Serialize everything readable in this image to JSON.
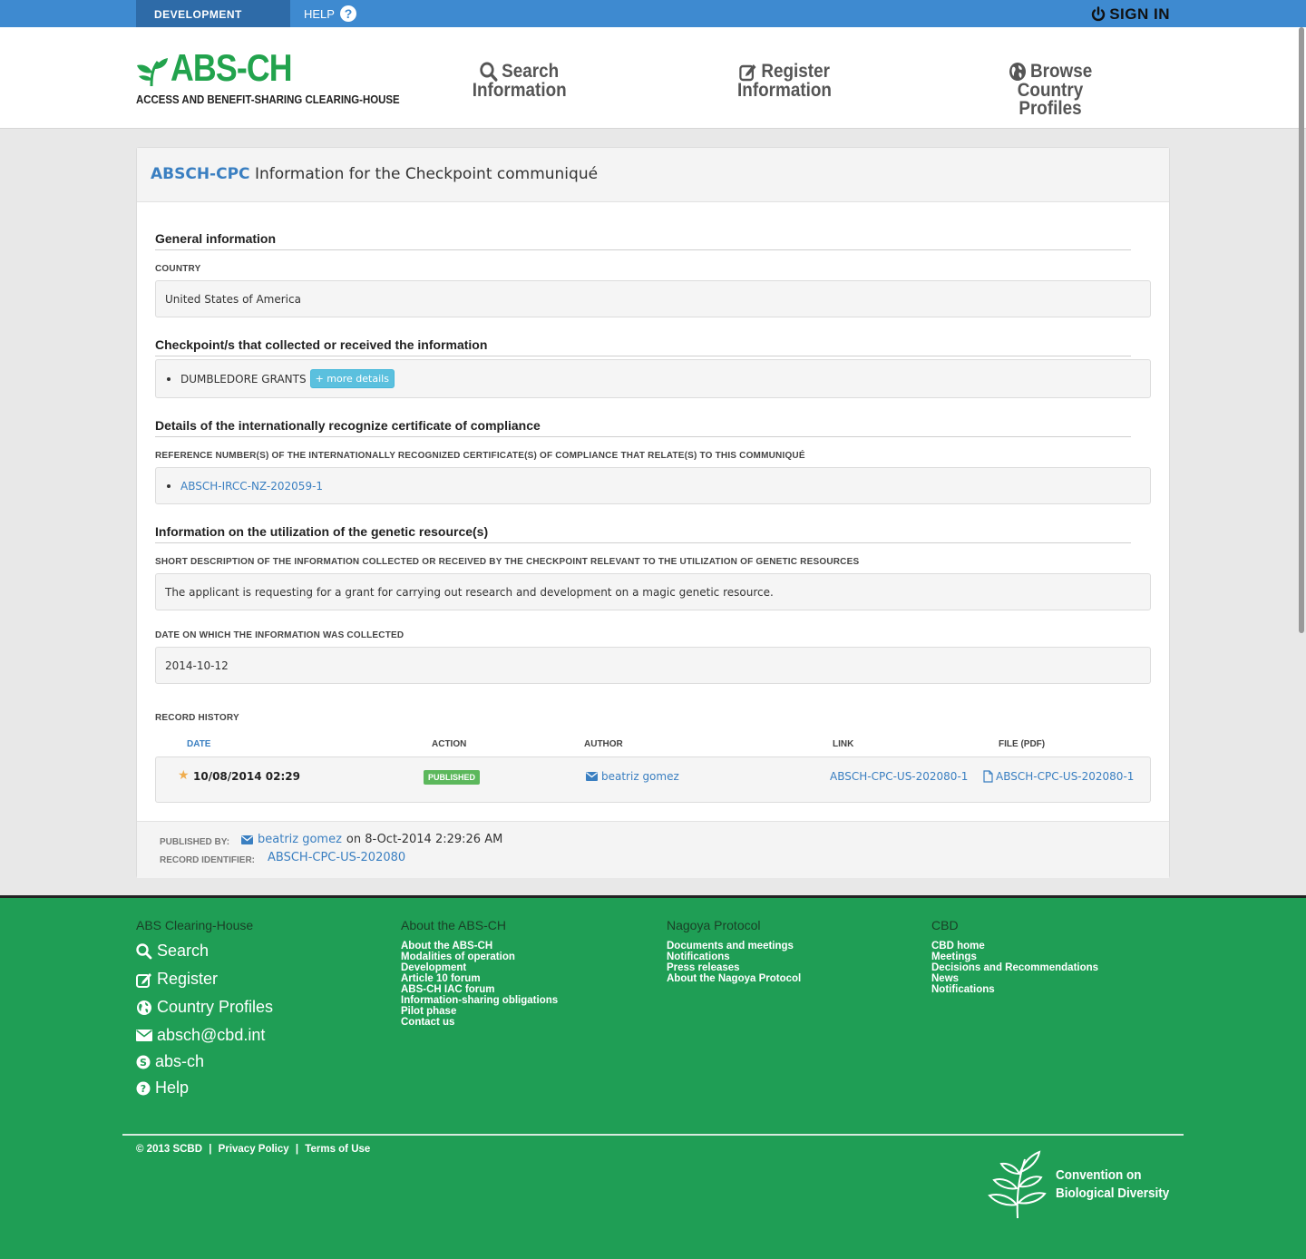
{
  "topbar": {
    "env_tab": "DEVELOPMENT",
    "help": "HELP",
    "help_icon": "?",
    "sign_in": "SIGN IN"
  },
  "header": {
    "logo_title": "ABS-CH",
    "logo_subtitle": "ACCESS AND BENEFIT-SHARING CLEARING-HOUSE",
    "nav": [
      {
        "line1": "Search",
        "line2": "Information",
        "icon": "search-icon"
      },
      {
        "line1": "Register",
        "line2": "Information",
        "icon": "edit-icon"
      },
      {
        "line1": "Browse",
        "line2": "Country Profiles",
        "icon": "globe-icon"
      }
    ]
  },
  "record": {
    "code": "ABSCH-CPC",
    "title": "Information for the Checkpoint communiqué",
    "general_title": "General information",
    "country_label": "COUNTRY",
    "country_value": "United States of America",
    "checkpoint_title": "Checkpoint/s that collected or received the information",
    "checkpoint_value": "DUMBLEDORE GRANTS",
    "more_details": "+ more details",
    "ircc_title": "Details of the internationally recognize certificate of compliance",
    "ircc_label": "REFERENCE NUMBER(S) OF THE INTERNATIONALLY RECOGNIZED CERTIFICATE(S) OF COMPLIANCE THAT RELATE(S) TO THIS COMMUNIQUÉ",
    "ircc_value": "ABSCH-IRCC-NZ-202059-1",
    "util_title": "Information on the utilization of the genetic resource(s)",
    "desc_label": "SHORT DESCRIPTION OF THE INFORMATION COLLECTED OR RECEIVED BY THE CHECKPOINT RELEVANT TO THE UTILIZATION OF GENETIC RESOURCES",
    "desc_value": "The applicant is requesting for a grant for carrying out research and development on a magic genetic resource.",
    "date_label": "DATE ON WHICH THE INFORMATION WAS COLLECTED",
    "date_value": "2014-10-12"
  },
  "history": {
    "label": "RECORD HISTORY",
    "columns": [
      "DATE",
      "ACTION",
      "AUTHOR",
      "LINK",
      "FILE (PDF)"
    ],
    "row": {
      "date": "10/08/2014 02:29",
      "action": "PUBLISHED",
      "author": "beatriz gomez",
      "link": "ABSCH-CPC-US-202080-1",
      "file": "ABSCH-CPC-US-202080-1"
    }
  },
  "meta": {
    "published_by_label": "PUBLISHED BY:",
    "published_by": "beatriz gomez",
    "published_on": "on 8-Oct-2014 2:29:26 AM",
    "identifier_label": "RECORD IDENTIFIER:",
    "identifier": "ABSCH-CPC-US-202080"
  },
  "footer": {
    "col1_title": "ABS Clearing-House",
    "col1_links": [
      {
        "label": "Search",
        "icon": "search-icon"
      },
      {
        "label": "Register",
        "icon": "edit-icon"
      },
      {
        "label": "Country Profiles",
        "icon": "globe-icon"
      },
      {
        "label": "absch@cbd.int",
        "icon": "envelope-icon"
      },
      {
        "label": "abs-ch",
        "icon": "skype-icon"
      },
      {
        "label": "Help",
        "icon": "help-icon"
      }
    ],
    "col2_title": "About the ABS-CH",
    "col2_links": [
      "About the ABS-CH",
      "Modalities of operation",
      "Development",
      "Article 10 forum",
      "ABS-CH IAC forum",
      "Information-sharing obligations",
      "Pilot phase",
      "Contact us"
    ],
    "col3_title": "Nagoya Protocol",
    "col3_links": [
      "Documents and meetings",
      "Notifications",
      "Press releases",
      "About the Nagoya Protocol"
    ],
    "col4_title": "CBD",
    "col4_links": [
      "CBD home",
      "Meetings",
      "Decisions and Recommendations",
      "News",
      "Notifications"
    ],
    "copyright": "© 2013 SCBD",
    "privacy": "Privacy Policy",
    "terms": "Terms of Use",
    "sep": "|",
    "cbd_line1": "Convention on",
    "cbd_line2": "Biological Diversity"
  },
  "colors": {
    "topbar": "#3e8ad0",
    "brand_green": "#22a34d",
    "footer_green": "#1f9e55",
    "link_blue": "#3a7fc1"
  }
}
